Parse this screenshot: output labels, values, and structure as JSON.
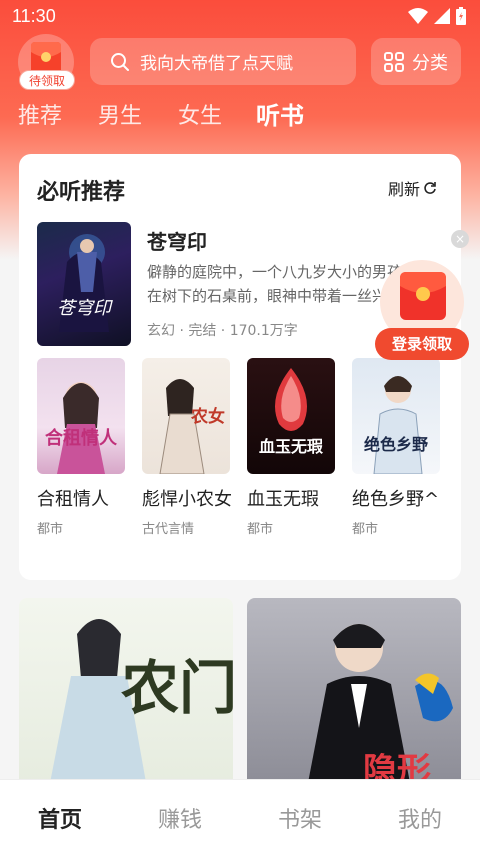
{
  "status_bar": {
    "time": "11:30"
  },
  "header": {
    "gift_label": "待领取",
    "search_placeholder": "我向大帝借了点天赋",
    "category_label": "分类"
  },
  "tabs": [
    {
      "label": "推荐"
    },
    {
      "label": "男生"
    },
    {
      "label": "女生"
    },
    {
      "label": "听书"
    }
  ],
  "recommend": {
    "title": "必听推荐",
    "refresh_label": "刷新",
    "featured": {
      "title": "苍穹印",
      "description": "僻静的庭院中，一个八九岁大小的男孩坐在树下的石桌前，眼神中带着一丝兴奋",
      "meta": "玄幻 · 完结 · 170.1万字",
      "cover_text": "苍穹印"
    },
    "books": [
      {
        "title": "合租情人",
        "genre": "都市",
        "cover_text": "合租情人"
      },
      {
        "title": "彪悍小农女",
        "genre": "古代言情",
        "cover_text": "农女"
      },
      {
        "title": "血玉无瑕",
        "genre": "都市",
        "cover_text": "血玉无瑕"
      },
      {
        "title": "绝色乡野^",
        "genre": "都市",
        "cover_text": "绝色乡野"
      }
    ]
  },
  "float_reward": {
    "label": "登录领取",
    "close": "×"
  },
  "bottom_books": [
    {
      "cover_text": "农门"
    },
    {
      "cover_text": "隐形"
    }
  ],
  "bottom_nav": [
    {
      "label": "首页"
    },
    {
      "label": "赚钱"
    },
    {
      "label": "书架"
    },
    {
      "label": "我的"
    }
  ],
  "colors": {
    "accent": "#f04a2f",
    "hero_top": "#fb4d3c"
  }
}
